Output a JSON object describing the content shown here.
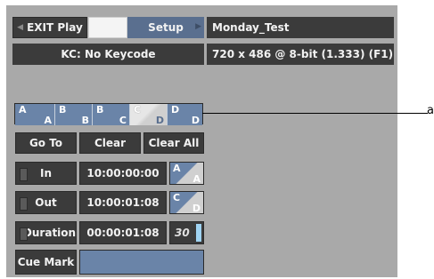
{
  "toolbar": {
    "exit_label": "EXIT Play",
    "setup_label": "Setup",
    "clip_name": "Monday_Test",
    "keycode": "KC: No Keycode",
    "format": "720 x 486 @ 8-bit (1.333) (F1)"
  },
  "track_selector": {
    "segments": [
      {
        "top": "A",
        "bottom": "A"
      },
      {
        "top": "B",
        "bottom": "B"
      },
      {
        "top": "B",
        "bottom": "C"
      },
      {
        "top": "C",
        "bottom": "D"
      },
      {
        "top": "D",
        "bottom": "D"
      }
    ]
  },
  "actions": {
    "goto_label": "Go To",
    "clear_label": "Clear",
    "clear_all_label": "Clear All"
  },
  "timecodes": {
    "in_label": "In",
    "in_value": "10:00:00:00",
    "in_track_top": "A",
    "in_track_bottom": "A",
    "out_label": "Out",
    "out_value": "10:00:01:08",
    "out_track_top": "C",
    "out_track_bottom": "D",
    "duration_label": "Duration",
    "duration_value": "00:00:01:08",
    "fps": "30"
  },
  "cue": {
    "cue_mark_label": "Cue Mark",
    "cue_value": ""
  },
  "callout": {
    "label": "a"
  }
}
